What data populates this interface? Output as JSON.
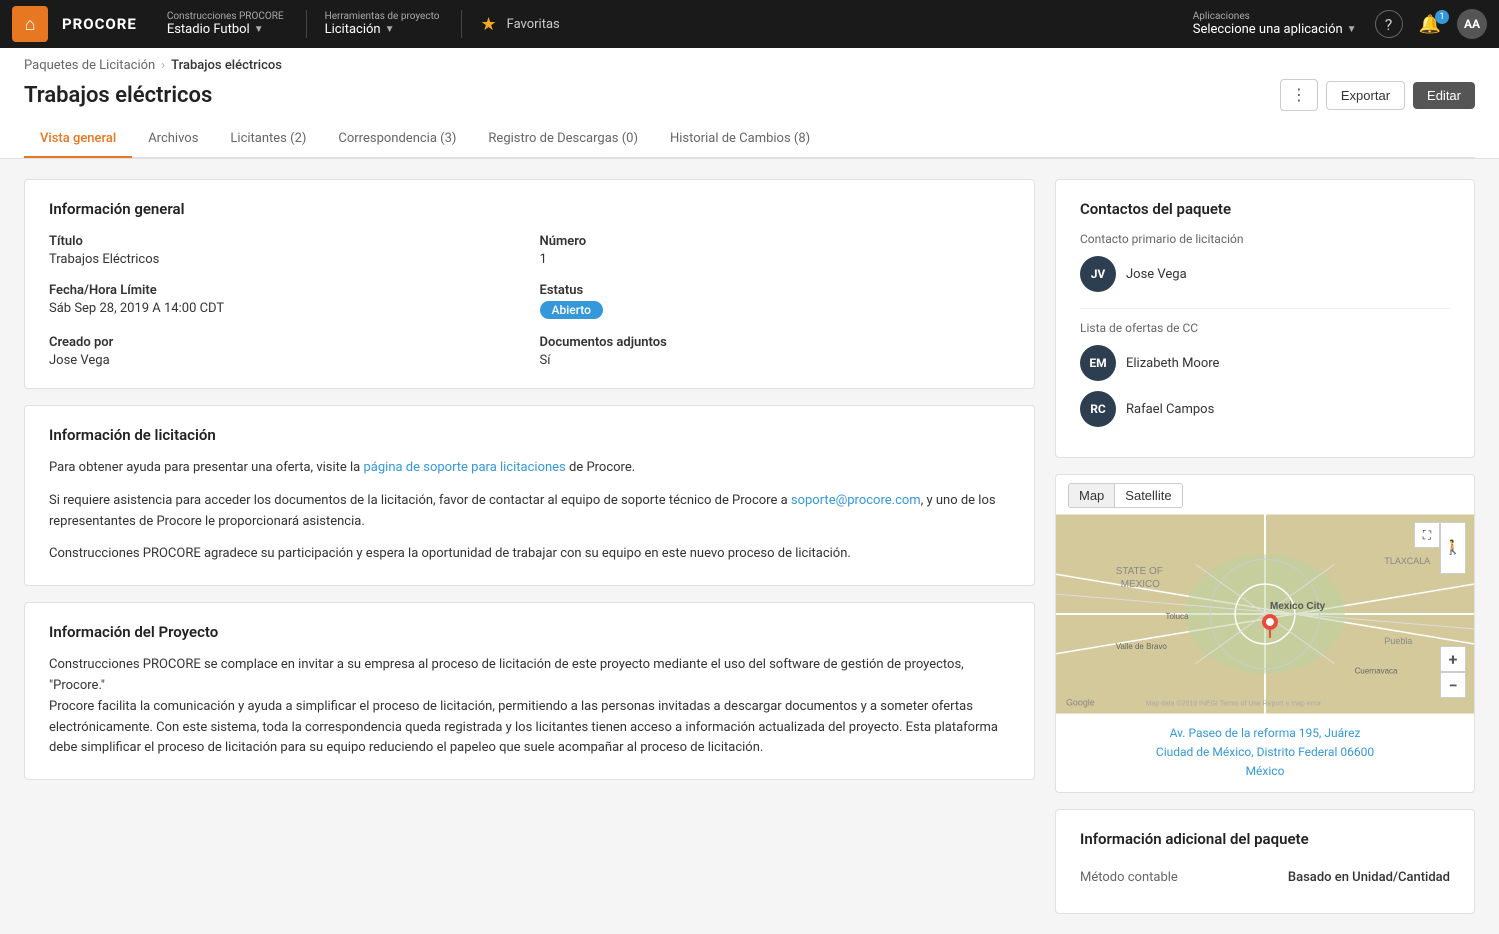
{
  "topnav": {
    "logo_text": "⌂",
    "brand": "PROCORE",
    "project_label": "Construcciones PROCORE",
    "project_value": "Estadio Futbol",
    "tools_label": "Herramientas de proyecto",
    "tools_value": "Licitación",
    "favorites_label": "Favoritas",
    "apps_label": "Aplicaciones",
    "apps_value": "Seleccione una aplicación",
    "help_icon": "?",
    "notifications_count": "1",
    "avatar_initials": "AA"
  },
  "breadcrumb": {
    "parent": "Paquetes de Licitación",
    "separator": "›",
    "current": "Trabajos eléctricos"
  },
  "page": {
    "title": "Trabajos eléctricos",
    "actions": {
      "dots": "⋮",
      "export": "Exportar",
      "edit": "Editar"
    }
  },
  "tabs": [
    {
      "label": "Vista general",
      "active": true,
      "count": null
    },
    {
      "label": "Archivos",
      "active": false,
      "count": null
    },
    {
      "label": "Licitantes (2)",
      "active": false,
      "count": null
    },
    {
      "label": "Correspondencia (3)",
      "active": false,
      "count": null
    },
    {
      "label": "Registro de Descargas (0)",
      "active": false,
      "count": null
    },
    {
      "label": "Historial de Cambios (8)",
      "active": false,
      "count": null
    }
  ],
  "general_info": {
    "card_title": "Información general",
    "fields": {
      "titulo_label": "Título",
      "titulo_value": "Trabajos Eléctricos",
      "numero_label": "Número",
      "numero_value": "1",
      "fecha_label": "Fecha/Hora Límite",
      "fecha_value": "Sáb Sep 28, 2019 A 14:00 CDT",
      "estatus_label": "Estatus",
      "estatus_value": "Abierto",
      "creado_label": "Creado por",
      "creado_value": "Jose Vega",
      "documentos_label": "Documentos adjuntos",
      "documentos_value": "Sí"
    }
  },
  "bidding_info": {
    "card_title": "Información de licitación",
    "paragraph1_start": "Para obtener ayuda para presentar una oferta, visite la ",
    "paragraph1_link_text": "página de soporte para licitaciones",
    "paragraph1_link_url": "#",
    "paragraph1_end": " de Procore.",
    "paragraph2_start": "Si requiere asistencia para acceder los documentos de la licitación, favor de contactar al equipo de soporte técnico de Procore a ",
    "paragraph2_link_text": "soporte@procore.com",
    "paragraph2_link_url": "#",
    "paragraph2_end": ", y uno de los representantes de Procore le proporcionará asistencia.",
    "paragraph3": "Construcciones PROCORE agradece su participación y espera la oportunidad de trabajar con su equipo en este nuevo proceso de licitación."
  },
  "project_info": {
    "card_title": "Información del Proyecto",
    "text": "Construcciones PROCORE se complace en invitar a su empresa al proceso de licitación de este proyecto mediante el uso del software de gestión de proyectos, \"Procore.\"\nProcore facilita la comunicación y ayuda a simplificar el proceso de licitación, permitiendo a las personas invitadas a descargar documentos y a someter ofertas electrónicamente. Con este sistema, toda la correspondencia queda registrada y los licitantes tienen acceso a información actualizada del proyecto. Esta plataforma debe simplificar el proceso de licitación para su equipo reduciendo el papeleo que suele acompañar al proceso de licitación."
  },
  "contacts": {
    "card_title": "Contactos del paquete",
    "primary_label": "Contacto primario de licitación",
    "primary": {
      "initials": "JV",
      "name": "Jose Vega"
    },
    "cc_label": "Lista de ofertas de CC",
    "cc_contacts": [
      {
        "initials": "EM",
        "name": "Elizabeth Moore"
      },
      {
        "initials": "RC",
        "name": "Rafael Campos"
      }
    ]
  },
  "map": {
    "tab_map": "Map",
    "tab_satellite": "Satellite",
    "fullscreen_icon": "⛶",
    "zoom_in": "+",
    "zoom_out": "−",
    "street_view_icon": "🚶",
    "address_line1": "Av. Paseo de la reforma 195, Juárez",
    "address_line2": "Ciudad de México, Distrito Federal 06600",
    "address_line3": "México"
  },
  "additional_info": {
    "card_title": "Información adicional del paquete",
    "fields": [
      {
        "label": "Método contable",
        "value": "Basado en Unidad/Cantidad"
      }
    ]
  }
}
